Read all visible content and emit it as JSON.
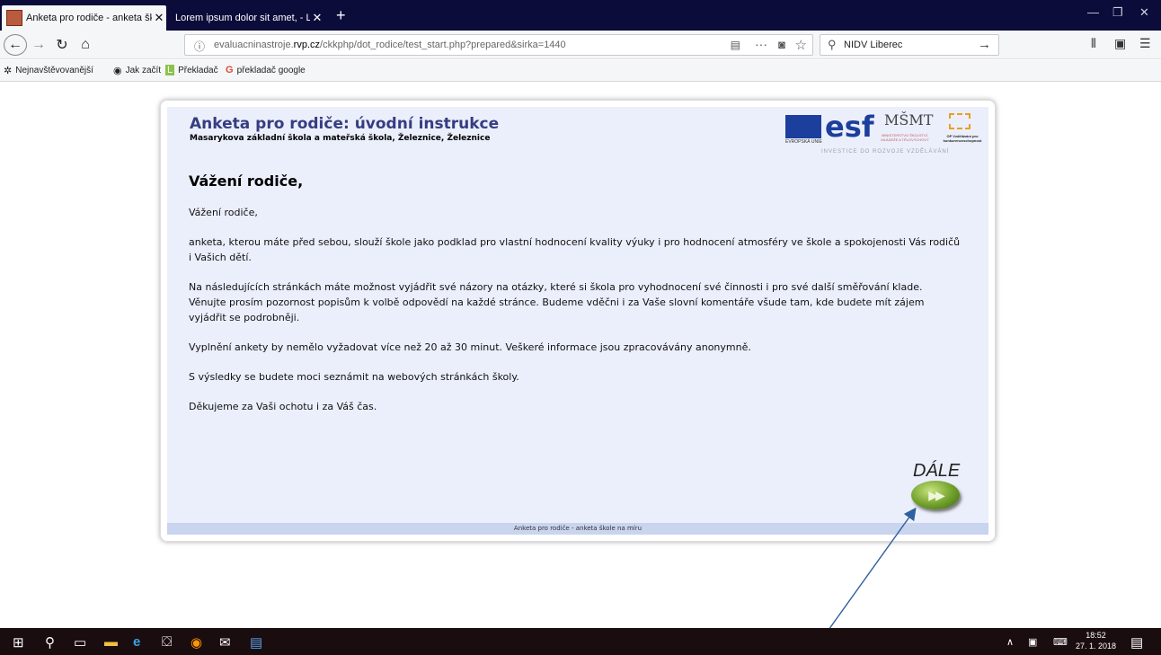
{
  "browser": {
    "tabs": [
      {
        "title": "Anketa pro rodiče - anketa škol"
      },
      {
        "title": "Lorem ipsum dolor sit amet, - Linkt"
      }
    ],
    "new_tab": "+",
    "url_prefix": "evaluacninastroje.",
    "url_domain": "rvp.cz",
    "url_rest": "/ckkphp/dot_rodice/test_start.php?prepared&sirka=1440",
    "search_value": "NIDV Liberec",
    "bookmarks": [
      {
        "label": "Nejnavštěvovanější",
        "icon": "gear-icon"
      },
      {
        "label": "Jak začít",
        "icon": "firefox-icon"
      },
      {
        "label": "Překladač",
        "icon": "translator-icon"
      },
      {
        "label": "překladač google",
        "icon": "google-icon"
      }
    ]
  },
  "page": {
    "title": "Anketa pro rodiče: úvodní instrukce",
    "subtitle": "Masarykova základní škola a mateřská škola, Železnice, Železnice",
    "logos": {
      "eu_caption": "EVROPSKÁ UNIE",
      "esf": "esf",
      "msmt": "MŠMT",
      "msmt_caption": "MINISTERSTVO ŠKOLSTVÍ, MLÁDEŽE A TĚLOVÝCHOVY",
      "op_caption": "OP Vzdělávání pro konkurenceschopnost",
      "invest_caption": "INVESTICE DO ROZVOJE VZDĚLÁVÁNÍ"
    },
    "greeting": "Vážení rodiče,",
    "paragraphs": [
      "Vážení rodiče,",
      "anketa, kterou máte před sebou, slouží škole jako podklad pro vlastní hodnocení kvality výuky i pro hodnocení atmosféry ve škole a spokojenosti Vás rodičů i Vašich dětí.",
      "Na následujících stránkách máte možnost vyjádřit své názory na otázky, které si škola pro vyhodnocení své činnosti i pro své další směřování klade. Věnujte prosím pozornost popisům k volbě odpovědí na každé stránce. Budeme vděčni i za Vaše slovní komentáře všude tam, kde budete mít zájem vyjádřit se podrobněji.",
      "Vyplnění ankety by nemělo vyžadovat více než 20 až 30 minut. Veškeré informace jsou zpracovávány anonymně.",
      "S výsledky se budete moci seznámit na webových stránkách školy.",
      "Děkujeme za Vaši ochotu i za Váš čas."
    ],
    "next_button": "DÁLE",
    "footer": "Anketa pro rodiče - anketa škole na míru"
  },
  "taskbar": {
    "time": "18:52",
    "date": "27. 1. 2018"
  },
  "colors": {
    "title": "#363d80",
    "panel_bg": "#ebeffb",
    "footer_bg": "#c9d4ee",
    "tabbar_bg": "#0c0c3b",
    "arrow": "#2e5f9e"
  }
}
